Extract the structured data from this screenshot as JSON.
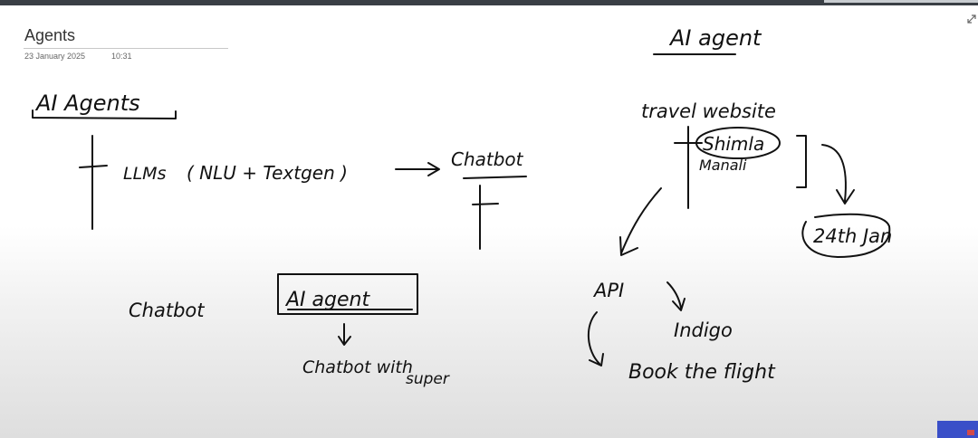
{
  "page": {
    "title": "Agents",
    "date": "23 January 2025",
    "time": "10:31"
  },
  "ink": {
    "heading": "AI Agents",
    "llms": "LLMs",
    "nlu_textgen": "( NLU + Textgen )",
    "chatbot_top": "Chatbot",
    "ai_agent_top": "AI agent",
    "travel_website": "travel website",
    "shimla": "Shimla",
    "manali": "Manali",
    "date_24jan": "24th Jan",
    "chatbot_bottom": "Chatbot",
    "ai_agent_box": "AI agent",
    "chatbot_with": "Chatbot with",
    "super": "super",
    "api": "API",
    "indigo": "Indigo",
    "book_flight": "Book the flight"
  },
  "icons": {
    "expand": "expand-icon"
  }
}
